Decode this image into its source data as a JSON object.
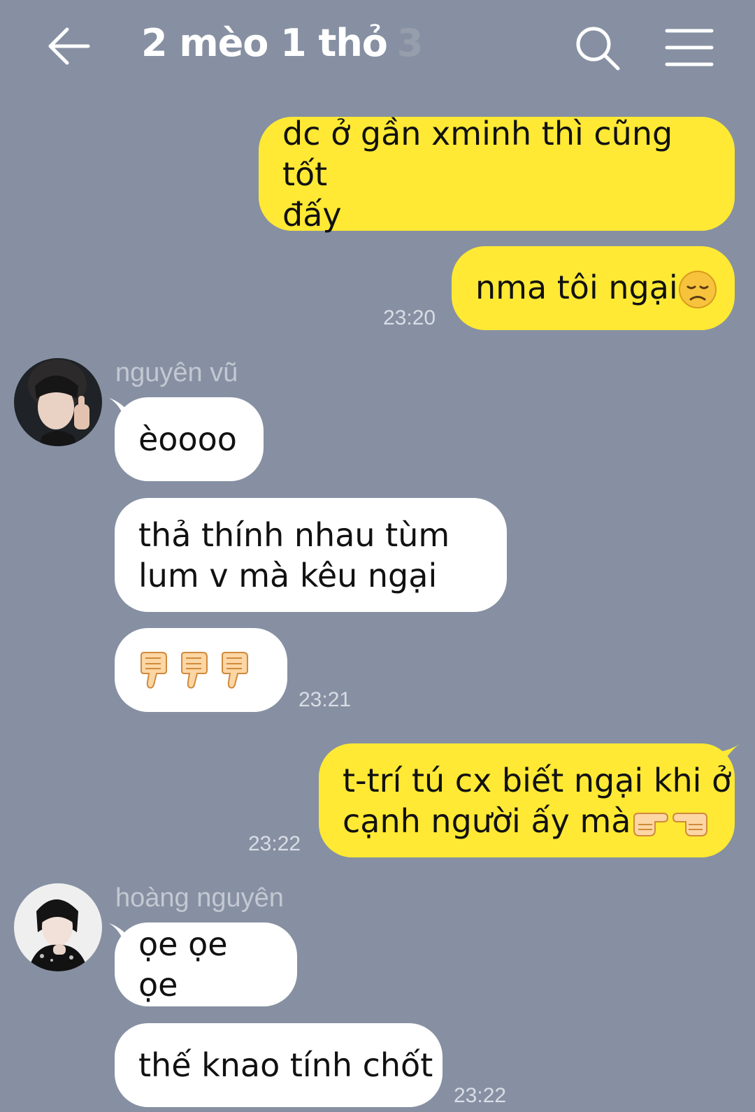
{
  "header": {
    "title": "2 mèo 1 thỏ",
    "member_count": "3"
  },
  "colors": {
    "background": "#8690a2",
    "outgoing_bubble": "#ffe934",
    "incoming_bubble": "#ffffff"
  },
  "messages": [
    {
      "direction": "out",
      "lines": [
        "dc ở gần xminh thì cũng tốt",
        "đấy"
      ]
    },
    {
      "direction": "out",
      "text": "nma tôi ngại",
      "emoji": "disappointed-face",
      "time": "23:20"
    },
    {
      "direction": "in",
      "sender": "nguyên vũ",
      "text": "èoooo"
    },
    {
      "direction": "in",
      "lines": [
        "thả thính nhau tùm",
        "lum v mà kêu ngại"
      ]
    },
    {
      "direction": "in",
      "emoji": "thumbs-down x3",
      "time": "23:21"
    },
    {
      "direction": "out",
      "lines": [
        "t-trí tú cx biết ngại khi ở",
        "cạnh người ấy mà"
      ],
      "emoji": "pointing-fingers",
      "time": "23:22"
    },
    {
      "direction": "in",
      "sender": "hoàng nguyên",
      "text": "ọe ọe ọe"
    },
    {
      "direction": "in",
      "text": "thế knao tính chốt",
      "time": "23:22"
    }
  ]
}
